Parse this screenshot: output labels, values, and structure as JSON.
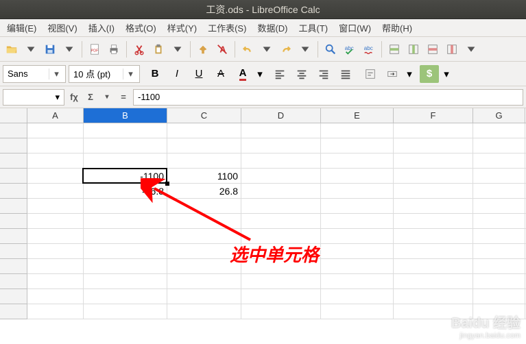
{
  "title": "工资.ods - LibreOffice Calc",
  "menu": {
    "edit": "编辑(E)",
    "view": "视图(V)",
    "insert": "插入(I)",
    "format": "格式(O)",
    "style": "样式(Y)",
    "sheet": "工作表(S)",
    "data": "数据(D)",
    "tools": "工具(T)",
    "window": "窗口(W)",
    "help": "帮助(H)"
  },
  "font": {
    "name": "Sans",
    "size": "10 点 (pt)"
  },
  "formula": {
    "ref": "",
    "value": "-1100",
    "fx": "fχ",
    "sigma": "Σ",
    "eq": "="
  },
  "cols": {
    "A": "A",
    "B": "B",
    "C": "C",
    "D": "D",
    "E": "E",
    "F": "F",
    "G": "G"
  },
  "cells": {
    "b4": "-1100",
    "c4": "1100",
    "b5": "-26.8",
    "c5": "26.8"
  },
  "annotation": "选中单元格",
  "watermark": {
    "brand": "Baidu 经验",
    "url": "jingyan.baidu.com"
  },
  "chart_data": {
    "type": "table",
    "selected_cell": "B4",
    "formula_bar": "-1100",
    "values": [
      {
        "cell": "B4",
        "value": -1100
      },
      {
        "cell": "C4",
        "value": 1100
      },
      {
        "cell": "B5",
        "value": -26.8
      },
      {
        "cell": "C5",
        "value": 26.8
      }
    ]
  }
}
